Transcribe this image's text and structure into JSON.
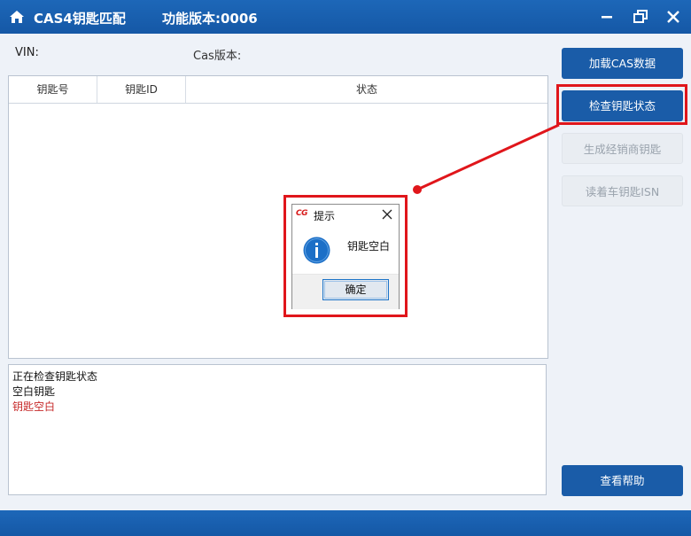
{
  "window": {
    "title": "CAS4钥匙匹配",
    "version": "功能版本:0006",
    "icons": {
      "home": "home-icon",
      "minimize": "minimize-icon",
      "maximize": "restore-icon",
      "close": "close-icon"
    }
  },
  "info": {
    "vin_label": "VIN:",
    "cas_version_label": "Cas版本:"
  },
  "table": {
    "columns": [
      "钥匙号",
      "钥匙ID",
      "状态"
    ],
    "rows": []
  },
  "log": {
    "lines": [
      {
        "text": "正在检查钥匙状态",
        "color": "#111111"
      },
      {
        "text": "空白钥匙",
        "color": "#111111"
      },
      {
        "text": "钥匙空白",
        "color": "#c62828"
      }
    ]
  },
  "sidebar": {
    "load_cas": "加载CAS数据",
    "check_key": "检查钥匙状态",
    "gen_dealer_key": "生成经销商钥匙",
    "read_car_key_isn": "读着车钥匙ISN",
    "help": "查看帮助"
  },
  "dialog": {
    "title": "提示",
    "logo_text": "CG",
    "message": "钥匙空白",
    "ok_label": "确定",
    "icon": "info-icon"
  },
  "colors": {
    "accent": "#1a5ca8",
    "highlight": "#e0161b",
    "error_text": "#c62828"
  }
}
